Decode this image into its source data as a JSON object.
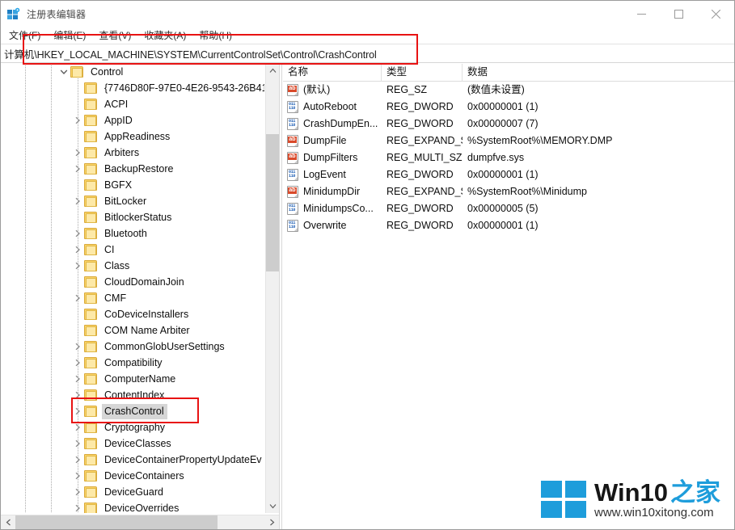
{
  "window": {
    "title": "注册表编辑器",
    "app_icon": "registry-editor-icon",
    "minimize_label": "最小化",
    "maximize_label": "最大化",
    "close_label": "关闭"
  },
  "menubar": {
    "items": [
      {
        "label": "文件(F)",
        "name": "menu-file"
      },
      {
        "label": "编辑(E)",
        "name": "menu-edit"
      },
      {
        "label": "查看(V)",
        "name": "menu-view"
      },
      {
        "label": "收藏夹(A)",
        "name": "menu-favorites"
      },
      {
        "label": "帮助(H)",
        "name": "menu-help"
      }
    ]
  },
  "address": {
    "value": "计算机\\HKEY_LOCAL_MACHINE\\SYSTEM\\CurrentControlSet\\Control\\CrashControl",
    "placeholder": "计算机"
  },
  "tree": {
    "items": [
      {
        "label": "Control",
        "indent": 0,
        "expander": "down",
        "selected": false
      },
      {
        "label": "{7746D80F-97E0-4E26-9543-26B41",
        "indent": 1,
        "expander": "none",
        "selected": false
      },
      {
        "label": "ACPI",
        "indent": 1,
        "expander": "none",
        "selected": false
      },
      {
        "label": "AppID",
        "indent": 1,
        "expander": "right",
        "selected": false
      },
      {
        "label": "AppReadiness",
        "indent": 1,
        "expander": "none",
        "selected": false
      },
      {
        "label": "Arbiters",
        "indent": 1,
        "expander": "right",
        "selected": false
      },
      {
        "label": "BackupRestore",
        "indent": 1,
        "expander": "right",
        "selected": false
      },
      {
        "label": "BGFX",
        "indent": 1,
        "expander": "none",
        "selected": false
      },
      {
        "label": "BitLocker",
        "indent": 1,
        "expander": "right",
        "selected": false
      },
      {
        "label": "BitlockerStatus",
        "indent": 1,
        "expander": "none",
        "selected": false
      },
      {
        "label": "Bluetooth",
        "indent": 1,
        "expander": "right",
        "selected": false
      },
      {
        "label": "CI",
        "indent": 1,
        "expander": "right",
        "selected": false
      },
      {
        "label": "Class",
        "indent": 1,
        "expander": "right",
        "selected": false
      },
      {
        "label": "CloudDomainJoin",
        "indent": 1,
        "expander": "none",
        "selected": false
      },
      {
        "label": "CMF",
        "indent": 1,
        "expander": "right",
        "selected": false
      },
      {
        "label": "CoDeviceInstallers",
        "indent": 1,
        "expander": "none",
        "selected": false
      },
      {
        "label": "COM Name Arbiter",
        "indent": 1,
        "expander": "none",
        "selected": false
      },
      {
        "label": "CommonGlobUserSettings",
        "indent": 1,
        "expander": "right",
        "selected": false
      },
      {
        "label": "Compatibility",
        "indent": 1,
        "expander": "right",
        "selected": false
      },
      {
        "label": "ComputerName",
        "indent": 1,
        "expander": "right",
        "selected": false
      },
      {
        "label": "ContentIndex",
        "indent": 1,
        "expander": "right",
        "selected": false
      },
      {
        "label": "CrashControl",
        "indent": 1,
        "expander": "right",
        "selected": true
      },
      {
        "label": "Cryptography",
        "indent": 1,
        "expander": "right",
        "selected": false
      },
      {
        "label": "DeviceClasses",
        "indent": 1,
        "expander": "right",
        "selected": false
      },
      {
        "label": "DeviceContainerPropertyUpdateEv",
        "indent": 1,
        "expander": "right",
        "selected": false
      },
      {
        "label": "DeviceContainers",
        "indent": 1,
        "expander": "right",
        "selected": false
      },
      {
        "label": "DeviceGuard",
        "indent": 1,
        "expander": "right",
        "selected": false
      },
      {
        "label": "DeviceOverrides",
        "indent": 1,
        "expander": "right",
        "selected": false
      }
    ]
  },
  "list": {
    "columns": [
      {
        "label": "名称",
        "name": "column-name"
      },
      {
        "label": "类型",
        "name": "column-type"
      },
      {
        "label": "数据",
        "name": "column-data"
      }
    ],
    "rows": [
      {
        "icon": "string-value-icon",
        "name": "(默认)",
        "type": "REG_SZ",
        "data": "(数值未设置)"
      },
      {
        "icon": "dword-value-icon",
        "name": "AutoReboot",
        "type": "REG_DWORD",
        "data": "0x00000001 (1)"
      },
      {
        "icon": "dword-value-icon",
        "name": "CrashDumpEn...",
        "type": "REG_DWORD",
        "data": "0x00000007 (7)"
      },
      {
        "icon": "string-value-icon",
        "name": "DumpFile",
        "type": "REG_EXPAND_SZ",
        "data": "%SystemRoot%\\MEMORY.DMP"
      },
      {
        "icon": "string-value-icon",
        "name": "DumpFilters",
        "type": "REG_MULTI_SZ",
        "data": "dumpfve.sys"
      },
      {
        "icon": "dword-value-icon",
        "name": "LogEvent",
        "type": "REG_DWORD",
        "data": "0x00000001 (1)"
      },
      {
        "icon": "string-value-icon",
        "name": "MinidumpDir",
        "type": "REG_EXPAND_SZ",
        "data": "%SystemRoot%\\Minidump"
      },
      {
        "icon": "dword-value-icon",
        "name": "MinidumpsCo...",
        "type": "REG_DWORD",
        "data": "0x00000005 (5)"
      },
      {
        "icon": "dword-value-icon",
        "name": "Overwrite",
        "type": "REG_DWORD",
        "data": "0x00000001 (1)"
      }
    ]
  },
  "watermark": {
    "brand_en": "Win10",
    "brand_cn": "之家",
    "url": "www.win10xitong.com"
  },
  "colors": {
    "annotation": "#e81313",
    "accent": "#1e9ddb",
    "selection": "#d6d6d6",
    "folder": "#fbd56a"
  },
  "icons": {
    "string_value_tag": "ab",
    "dword_value_bits_top": "011",
    "dword_value_bits_bottom": "110"
  }
}
